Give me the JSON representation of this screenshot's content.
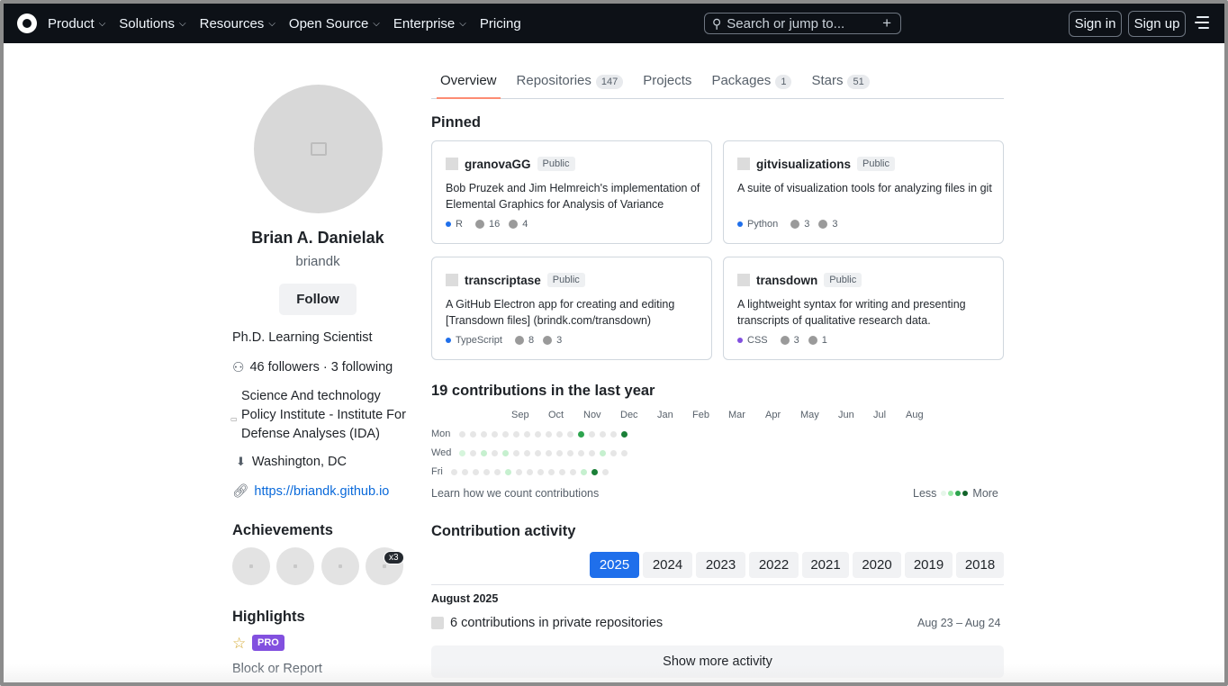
{
  "header": {
    "logo_icon": "github-mark-icon",
    "nav": [
      {
        "label": "Product",
        "dropdown": true
      },
      {
        "label": "Solutions",
        "dropdown": true
      },
      {
        "label": "Resources",
        "dropdown": true
      },
      {
        "label": "Open Source",
        "dropdown": true
      },
      {
        "label": "Enterprise",
        "dropdown": true
      },
      {
        "label": "Pricing",
        "dropdown": false
      }
    ],
    "search_placeholder": "Search or jump to...",
    "signin": "Sign in",
    "signup": "Sign up"
  },
  "profile": {
    "name": "Brian A. Danielak",
    "login": "briandk",
    "follow": "Follow",
    "bio": "Ph.D. Learning Scientist",
    "followers": "46 followers · 3 following",
    "org": "Science And technology Policy Institute - Institute For Defense Analyses (IDA)",
    "location": "Washington, DC",
    "url": "https://briandk.github.io",
    "achievements_title": "Achievements",
    "achievement_multiplier": "x3",
    "highlights_title": "Highlights",
    "pro": "PRO",
    "block": "Block or Report"
  },
  "tabs": [
    {
      "label": "Overview",
      "count": ""
    },
    {
      "label": "Repositories",
      "count": "147"
    },
    {
      "label": "Projects",
      "count": ""
    },
    {
      "label": "Packages",
      "count": "1"
    },
    {
      "label": "Stars",
      "count": "51"
    }
  ],
  "pinned_title": "Pinned",
  "pinned": [
    {
      "name": "granovaGG",
      "visibility": "Public",
      "desc": "Bob Pruzek and Jim Helmreich's implementation of Elemental Graphics for Analysis of Variance",
      "lang": "R",
      "lang_color": "#198ce7",
      "stars": "16",
      "forks": "4"
    },
    {
      "name": "gitvisualizations",
      "visibility": "Public",
      "desc": "A suite of visualization tools for analyzing files in git",
      "lang": "Python",
      "lang_color": "#3572A5",
      "stars": "3",
      "forks": "3"
    },
    {
      "name": "transcriptase",
      "visibility": "Public",
      "desc": "A GitHub Electron app for creating and editing [Transdown files] (brindk.com/transdown)",
      "lang": "TypeScript",
      "lang_color": "#3178c6",
      "stars": "8",
      "forks": "3"
    },
    {
      "name": "transdown",
      "visibility": "Public",
      "desc": "A lightweight syntax for writing and presenting transcripts of qualitative research data.",
      "lang": "CSS",
      "lang_color": "#663399",
      "stars": "3",
      "forks": "1"
    }
  ],
  "contrib": {
    "title": "19 contributions in the last year",
    "months": [
      "Sep",
      "Oct",
      "Nov",
      "Dec",
      "Jan",
      "Feb",
      "Mar",
      "Apr",
      "May",
      "Jun",
      "Jul",
      "Aug"
    ],
    "days": [
      "Mon",
      "Wed",
      "Fri"
    ],
    "learn": "Learn how we count contributions",
    "less": "Less",
    "more": "More"
  },
  "activity": {
    "title": "Contribution activity",
    "years": [
      "2025",
      "2024",
      "2023",
      "2022",
      "2021",
      "2020",
      "2019",
      "2018"
    ],
    "selected": "2025",
    "month": "August 2025",
    "private": "6 contributions in private repositories",
    "range": "Aug 23 – Aug 24",
    "show_more": "Show more activity"
  }
}
